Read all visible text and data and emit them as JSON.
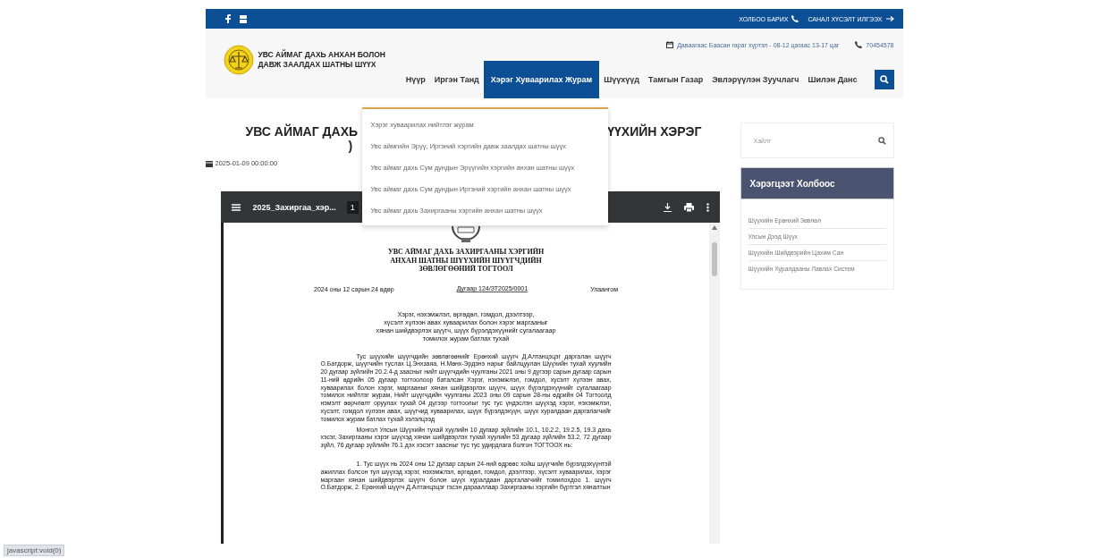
{
  "top_bar": {
    "contact": "ХОЛБОО БАРИХ",
    "feedback": "САНАЛ ХҮСЭЛТ ИЛГЭЭХ"
  },
  "header": {
    "site_name": [
      "УВС АЙМАГ ДАХЬ АНХАН БОЛОН",
      "ДАВЖ ЗААЛДАХ ШАТНЫ ШҮҮХ"
    ],
    "hours": "Даваагаас Баасан гараг хүртэл - 08-12 цагаас 13-17 цаг",
    "phone": "70454578"
  },
  "nav": [
    {
      "label": "Нүүр",
      "selected": false
    },
    {
      "label": "Иргэн Танд",
      "selected": false
    },
    {
      "label": "Хэрэг Хуваарилах Журам",
      "selected": true
    },
    {
      "label": "Шүүхүүд",
      "selected": false
    },
    {
      "label": "Тамгын Газар",
      "selected": false
    },
    {
      "label": "Эвлэрүүлэн Зуучлагч",
      "selected": false
    },
    {
      "label": "Шилэн Данс",
      "selected": false
    }
  ],
  "nav_dropdown": [
    "Хэрэг хуваарилах нийтлэг журам",
    "Увс аймгийн Эрүү, Иргэний хэргийн давж заалдах шатны шүүх",
    "Увс аймаг дахь Сум дундын Эрүүгийн хэргийн анхан шатны шүүх",
    "Увс аймаг дахь Сум дундын Иргэний хэргийн анхан шатны шүүх",
    "Увс аймаг дахь Захиргааны хэргийн анхан шатны шүүх"
  ],
  "article": {
    "title_left": "УВС АЙМАГ ДАХЬ",
    "title_right": "ҮҮХИЙН ХЭРЭГ",
    "title_line2": ")",
    "date": "2025-01-09 00:00:00"
  },
  "pdf_viewer": {
    "file_name": "2025_Захиргаа_хэр...",
    "page": "1",
    "document": {
      "title": [
        "УВС АЙМАГ ДАХЬ ЗАХИРГААНЫ ХЭРГИЙН",
        "АНХАН ШАТНЫ ШҮҮХИЙН ШҮҮГЧДИЙН",
        "ЗӨВЛӨГӨӨНИЙ ТОГТООЛ"
      ],
      "date": "2024 оны 12 сарын 24 өдөр",
      "number": "Дугаар 124/ЗТ2025/0001",
      "place": "Улаангом",
      "subject": [
        "Хэрэг, нэхэмжлэл, өргөдөл, гомдол, дээлтээр,",
        "хүсэлт хүлээн авах хуваарилах болон хэрэг маргааныг",
        "хянан шийдвэрлэх шүүгч, шүүх бүрэлдэхүүнийг сугалаагаар",
        "томилох журам батлах тухай"
      ],
      "paragraphs": [
        "Тус шүүхийн шүүгчдийн зөвлөгөөнийг Ерөнхий шүүгч Д.Алтанцэцэг даргалан шүүгч О.Батдорж, шүүгчийн туслах Ц.Энхзаяа, Н.Мөнх-Эрдэнэ нарыг байлцуулан Шүүхийн тухай хуулийн 20 дугаар зүйлийн 20.2.4-д заасныг нийт шүүгчдийн чуулганы 2021 оны 9 дүгээр сарын дугаар сарын 11-ний өдрийн 05 дугаар тогтоолоор баталсан Хэрэг, нэхэмжлэл, гомдол, хүсэлт хүлээн авах, хуваарилах болон хэрэг, маргааныг хянан шийдвэрлэх шүүгч, шүүх бүрэлдэхүүнийг сугалаагаар томилох нийтлэг журам, Нийт шүүгчдийн чуулганы 2023 оны 09 сарын 28-ны өдрийн 04 Тогтоолд нэмэлт өөрчлөлт оруулах тухай 04 дүгээр тогтоолыг тус тус үндэслэн шүүхэд хэрэг, нэхэмжлэл, хүсэлт, гомдол хүлээн авах, шүүгчид хуваарилах, шүүх бүрэлдэхүүн, шүүх хуралдаан даргалагчийг томилох журам батлах тухай хэлэлцээд",
        "Монгол Улсын Шүүхийн тухай хуулийн 10 дугаар зүйлийн 10.1, 10.2.2, 19.2.5, 19.3 дахь хэсэг, Захиргааны хэрэг шүүхэд хянан шийдвэрлэх тухай хуулийн 53 дугаар зүйлийн 53.2, 72 дугаар зүйл, 76 дугаар зүйлийн 76.1 дэх хэсэгт заасныг тус тус удирдлага болгон ТОГТООХ нь:",
        "1. Тус шүүх нь 2024 оны 12 дугаар сарын 24-ний өдрөөс хойш шүүгчийн бүрэлдэхүүнтэй ажиллах болсон тул шүүхэд хэрэг, нэхэмжлэл, өргөдөл, гомдол, дээлтээр, хүсэлт хуваарилах, хэрэг маргаан хянан шийдвэрлэх шүүгч болон шүүх хуралдаан даргалагчийг томилохдоо 1. шүүгч О.Батдорж, 2. Ерөнхий шүүгч Д.Алтанцэцэг гэсэн дарааллаар Захиргааны хэргийн бүртгэл хяналтын"
      ]
    }
  },
  "sidebar": {
    "search_placeholder": "Хайлт",
    "links_title": "Хэрэгцээт Холбоос",
    "links": [
      "Шүүхийн Ерөнхий Зөвлөл",
      "Улсын Дээд Шүүх",
      "Шүүхийн Шийдвэрийн Цахим Сан",
      "Шүүхийн Хуралдааны Лавлах Систем"
    ]
  },
  "status_link": "javascript:void(0)"
}
